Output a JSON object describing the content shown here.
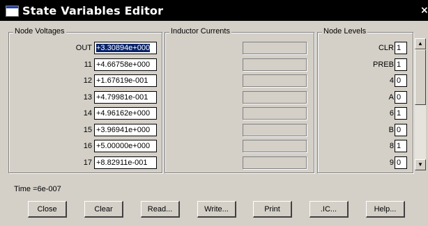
{
  "window": {
    "title": "State Variables Editor",
    "close_glyph": "×"
  },
  "node_voltages": {
    "legend": "Node Voltages",
    "rows": [
      {
        "label": "OUT",
        "value": "+3.30894e+000",
        "selected": true
      },
      {
        "label": "11",
        "value": "+4.66758e+000"
      },
      {
        "label": "12",
        "value": "+1.67619e-001"
      },
      {
        "label": "13",
        "value": "+4.79981e-001"
      },
      {
        "label": "14",
        "value": "+4.96162e+000"
      },
      {
        "label": "15",
        "value": "+3.96941e+000"
      },
      {
        "label": "16",
        "value": "+5.00000e+000"
      },
      {
        "label": "17",
        "value": "+8.82911e-001"
      }
    ]
  },
  "inductor_currents": {
    "legend": "Inductor Currents",
    "rows": [
      "",
      "",
      "",
      "",
      "",
      "",
      "",
      ""
    ]
  },
  "node_levels": {
    "legend": "Node Levels",
    "rows": [
      {
        "label": "CLR",
        "value": "1"
      },
      {
        "label": "PREB",
        "value": "1"
      },
      {
        "label": "4",
        "value": "0"
      },
      {
        "label": "A",
        "value": "0"
      },
      {
        "label": "6",
        "value": "1"
      },
      {
        "label": "B",
        "value": "0"
      },
      {
        "label": "8",
        "value": "1"
      },
      {
        "label": "9",
        "value": "0"
      }
    ]
  },
  "scrollbar": {
    "up_icon": "▲",
    "down_icon": "▼"
  },
  "status": {
    "time": "Time =6e-007"
  },
  "buttons": {
    "close": "Close",
    "clear": "Clear",
    "read": "Read...",
    "write": "Write...",
    "print": "Print",
    "ic": ".IC...",
    "help": "Help..."
  }
}
